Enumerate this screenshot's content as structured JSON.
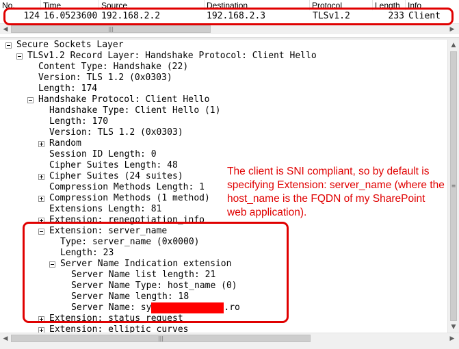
{
  "packet_list": {
    "columns": [
      "No.",
      "Time",
      "Source",
      "Destination",
      "Protocol",
      "Length",
      "Info"
    ],
    "row": {
      "no": "124",
      "time": "16.0523600",
      "source": "192.168.2.2",
      "destination": "192.168.2.3",
      "protocol": "TLSv1.2",
      "length": "233",
      "info": "Client"
    }
  },
  "tree": {
    "lines": [
      "Secure Sockets Layer",
      "TLSv1.2 Record Layer: Handshake Protocol: Client Hello",
      "Content Type: Handshake (22)",
      "Version: TLS 1.2 (0x0303)",
      "Length: 174",
      "Handshake Protocol: Client Hello",
      "Handshake Type: Client Hello (1)",
      "Length: 170",
      "Version: TLS 1.2 (0x0303)",
      "Random",
      "Session ID Length: 0",
      "Cipher Suites Length: 48",
      "Cipher Suites (24 suites)",
      "Compression Methods Length: 1",
      "Compression Methods (1 method)",
      "Extensions Length: 81",
      "Extension: renegotiation_info",
      "Extension: server_name",
      "Type: server_name (0x0000)",
      "Length: 23",
      "Server Name Indication extension",
      "Server Name list length: 21",
      "Server Name Type: host_name (0)",
      "Server Name length: 18",
      "Server Name: sy",
      "Extension: status_request",
      "Extension: elliptic_curves"
    ],
    "server_name_suffix": ".ro"
  },
  "annotation": {
    "text": "The client is SNI compliant, so by default is specifying Extension: server_name (where the host_name is the FQDN of my SharePoint web application).",
    "color": "#e00000"
  }
}
